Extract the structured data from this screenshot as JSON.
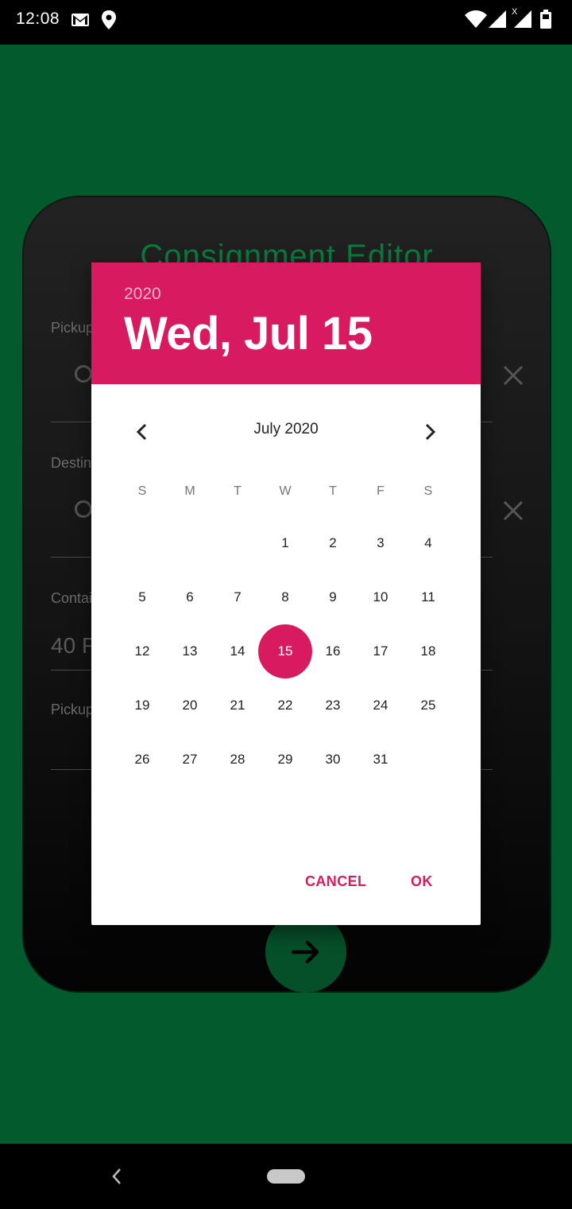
{
  "status_bar": {
    "time": "12:08",
    "icons": [
      "gmail-icon",
      "location-icon",
      "wifi-icon",
      "signal-icon",
      "signal-no-data-icon",
      "battery-icon"
    ]
  },
  "editor": {
    "title": "Consignment Editor",
    "fields": [
      {
        "label": "Pickup"
      },
      {
        "label": "Destin"
      },
      {
        "label": "Contai",
        "value": "40 F"
      },
      {
        "label": "Pickup"
      }
    ]
  },
  "date_picker": {
    "header": {
      "year": "2020",
      "date": "Wed, Jul 15"
    },
    "month_label": "July 2020",
    "weekdays": [
      "S",
      "M",
      "T",
      "W",
      "T",
      "F",
      "S"
    ],
    "weeks": [
      [
        "",
        "",
        "",
        "1",
        "2",
        "3",
        "4"
      ],
      [
        "5",
        "6",
        "7",
        "8",
        "9",
        "10",
        "11"
      ],
      [
        "12",
        "13",
        "14",
        "15",
        "16",
        "17",
        "18"
      ],
      [
        "19",
        "20",
        "21",
        "22",
        "23",
        "24",
        "25"
      ],
      [
        "26",
        "27",
        "28",
        "29",
        "30",
        "31",
        ""
      ]
    ],
    "selected_day": "15",
    "buttons": {
      "cancel": "CANCEL",
      "ok": "OK"
    },
    "accent_color": "#d81b60"
  },
  "colors": {
    "app_background": "#035a2c",
    "title_green": "#0a7a3d"
  }
}
